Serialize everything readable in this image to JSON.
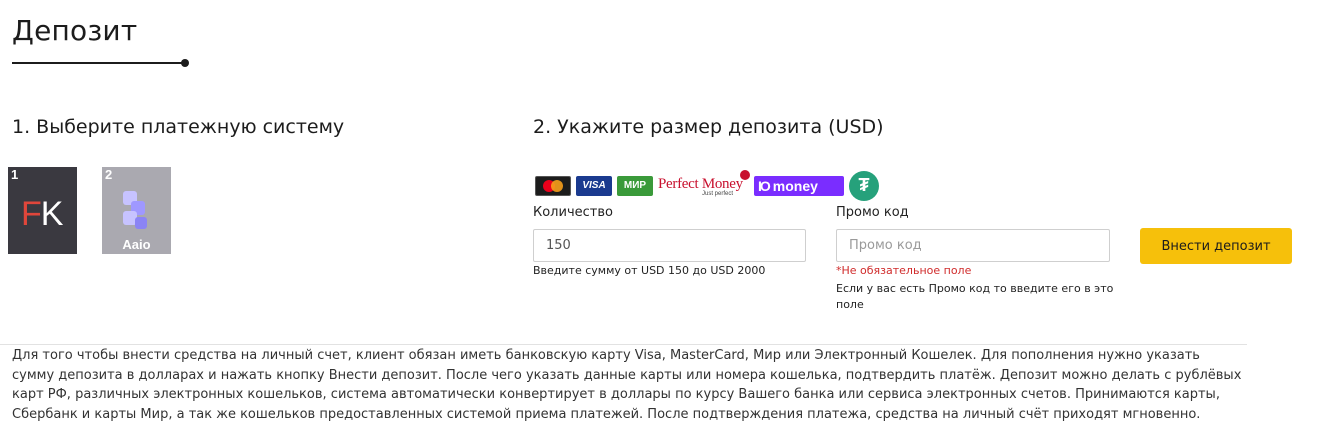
{
  "page": {
    "title": "Депозит"
  },
  "step1": {
    "heading": "1. Выберите платежную систему",
    "methods": [
      {
        "number": "1",
        "logo_text_f": "F",
        "logo_text_k": "K",
        "icon": "freekassa-logo"
      },
      {
        "number": "2",
        "label": "Aaio",
        "icon": "aaio-logo"
      }
    ]
  },
  "step2": {
    "heading": "2. Укажите размер депозита (USD)",
    "payment_logos": {
      "visa": "VISA",
      "mir": "МИР",
      "perfect_money": "Perfect Money",
      "perfect_money_sub": "Just perfect",
      "yoomoney": "money",
      "yoomoney_mark": "IO",
      "tether": "₮"
    },
    "amount": {
      "label": "Количество",
      "value": "150",
      "hint": "Введите сумму от USD 150 до USD 2000"
    },
    "promo": {
      "label": "Промо код",
      "placeholder": "Промо код",
      "optional_note": "*Не обязательное поле",
      "hint": "Если у вас есть Промо код то введите его в это поле"
    },
    "submit_label": "Внести депозит"
  },
  "info": {
    "text": "Для того чтобы внести средства на личный счет, клиент обязан иметь банковскую карту Visa, MasterCard, Мир или Электронный Кошелек. Для пополнения нужно указать сумму депозита в долларах и нажать кнопку Внести депозит. После чего указать данные карты или номера кошелька, подтвердить платёж. Депозит можно делать с рублёвых карт РФ, различных электронных кошельков, система автоматически конвертирует в доллары по курсу Вашего банка или сервиса электронных счетов. Принимаются карты, Сбербанк и карты Мир, а так же кошельков предоставленных системой приема платежей. После подтверждения платежа, средства на личный счёт приходят мгновенно."
  },
  "colors": {
    "accent_button": "#f6c00b",
    "error_text": "#d02b2b",
    "fk_tile": "#3a3940",
    "aaio_tile": "#aaa9b0"
  }
}
